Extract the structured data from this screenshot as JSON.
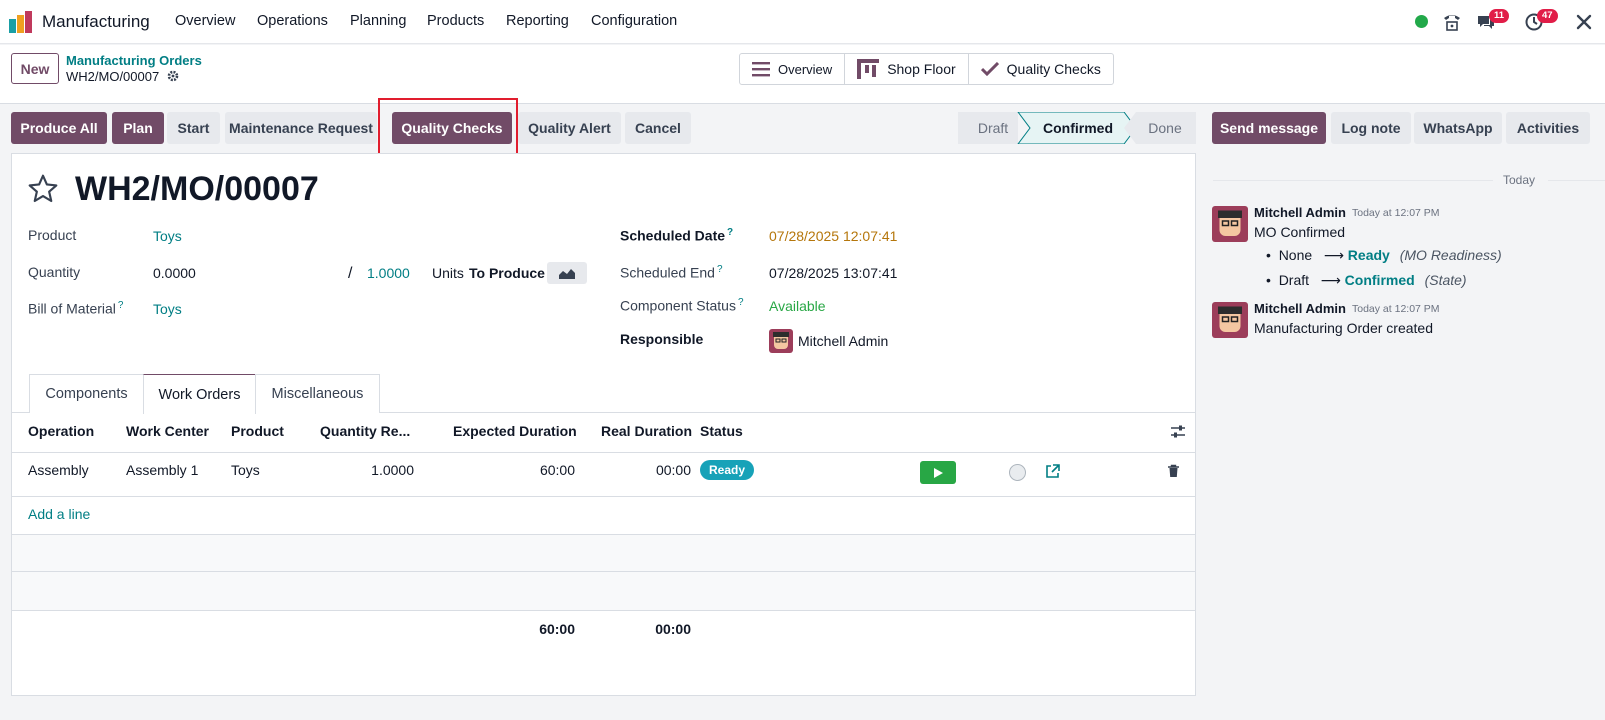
{
  "app": {
    "name": "Manufacturing"
  },
  "menu": [
    "Overview",
    "Operations",
    "Planning",
    "Products",
    "Reporting",
    "Configuration"
  ],
  "systray": {
    "messages_count": "11",
    "activities_count": "47"
  },
  "control": {
    "new_label": "New",
    "breadcrumb_parent": "Manufacturing Orders",
    "breadcrumb_current": "WH2/MO/00007"
  },
  "smart_buttons": {
    "overview": "Overview",
    "shop_floor": "Shop Floor",
    "quality_checks": "Quality Checks"
  },
  "actions": {
    "produce_all": "Produce All",
    "plan": "Plan",
    "start": "Start",
    "maintenance": "Maintenance Request",
    "quality_checks": "Quality Checks",
    "quality_alert": "Quality Alert",
    "cancel": "Cancel"
  },
  "statusbar": {
    "draft": "Draft",
    "confirmed": "Confirmed",
    "done": "Done",
    "active": "Confirmed"
  },
  "chatter_buttons": {
    "send": "Send message",
    "log": "Log note",
    "whatsapp": "WhatsApp",
    "activities": "Activities"
  },
  "form": {
    "title": "WH2/MO/00007",
    "product_label": "Product",
    "product_value": "Toys",
    "quantity_label": "Quantity",
    "quantity_value": "0.0000",
    "quantity_sep": "/",
    "quantity_target": "1.0000",
    "quantity_units": "Units",
    "to_produce": "To Produce",
    "bom_label": "Bill of Material",
    "bom_value": "Toys",
    "sched_date_label": "Scheduled Date",
    "sched_date_value": "07/28/2025 12:07:41",
    "sched_end_label": "Scheduled End",
    "sched_end_value": "07/28/2025 13:07:41",
    "comp_status_label": "Component Status",
    "comp_status_value": "Available",
    "responsible_label": "Responsible",
    "responsible_value": "Mitchell Admin",
    "help_mark": "?"
  },
  "tabs": [
    "Components",
    "Work Orders",
    "Miscellaneous"
  ],
  "table": {
    "headers": [
      "Operation",
      "Work Center",
      "Product",
      "Quantity Re...",
      "Expected Duration",
      "Real Duration",
      "Status"
    ],
    "rows": [
      {
        "operation": "Assembly",
        "work_center": "Assembly 1",
        "product": "Toys",
        "quantity": "1.0000",
        "expected": "60:00",
        "real": "00:00",
        "status": "Ready"
      }
    ],
    "add_line": "Add a line",
    "totals": {
      "expected": "60:00",
      "real": "00:00"
    }
  },
  "chatter": {
    "date_sep": "Today",
    "messages": [
      {
        "author": "Mitchell Admin",
        "time": "Today at 12:07 PM",
        "body": "MO Confirmed",
        "changes": [
          {
            "old": "None",
            "new": "Ready",
            "field": "(MO Readiness)"
          },
          {
            "old": "Draft",
            "new": "Confirmed",
            "field": "(State)"
          }
        ]
      },
      {
        "author": "Mitchell Admin",
        "time": "Today at 12:07 PM",
        "body": "Manufacturing Order created"
      }
    ]
  },
  "colors": {
    "primary": "#714B67",
    "link": "#017e84",
    "ready": "#17a2b8",
    "available": "#28a745",
    "warning_date": "#b5760b"
  }
}
